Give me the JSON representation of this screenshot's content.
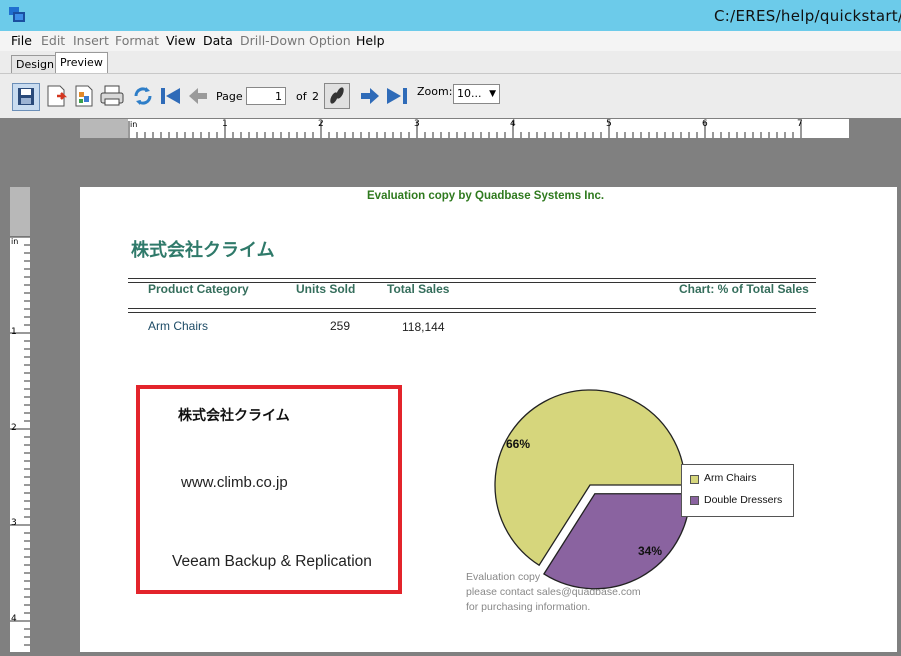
{
  "window": {
    "title": "C:/ERES/help/quickstart/"
  },
  "menu": [
    {
      "label": "File",
      "enabled": true
    },
    {
      "label": "Edit",
      "enabled": false
    },
    {
      "label": "Insert",
      "enabled": false
    },
    {
      "label": "Format",
      "enabled": false
    },
    {
      "label": "View",
      "enabled": true
    },
    {
      "label": "Data",
      "enabled": true
    },
    {
      "label": "Drill-Down",
      "enabled": false
    },
    {
      "label": "Option",
      "enabled": false
    },
    {
      "label": "Help",
      "enabled": true
    }
  ],
  "tabs": [
    {
      "label": "Design"
    },
    {
      "label": "Preview",
      "active": true
    }
  ],
  "toolbar": {
    "page_label": "Page",
    "page_value": "1",
    "of_label": "of",
    "total_pages": "2",
    "zoom_label": "Zoom:",
    "zoom_value": "10..."
  },
  "ruler": {
    "h_unit": "in",
    "h_marks": [
      "1",
      "2",
      "3",
      "4",
      "5",
      "6",
      "7"
    ],
    "v_unit": "in",
    "v_marks": [
      "1",
      "2",
      "3",
      "4"
    ]
  },
  "report": {
    "watermark": "Evaluation copy by Quadbase Systems Inc.",
    "title": "株式会社クライム",
    "headers": {
      "category": "Product Category",
      "units": "Units Sold",
      "sales": "Total Sales",
      "chart": "Chart: % of Total Sales"
    },
    "rows": [
      {
        "category": "Arm Chairs",
        "units": "259",
        "sales": "118,144"
      }
    ],
    "annotation": {
      "line1": "株式会社クライム",
      "line2": "www.climb.co.jp",
      "line3": "Veeam Backup & Replication",
      "border_color": "#e3242b"
    },
    "eval_note": [
      "Evaluation copy",
      "please contact sales@quadbase.com",
      "for purchasing information."
    ]
  },
  "chart_data": {
    "type": "pie",
    "title": "",
    "slices": [
      {
        "name": "Arm Chairs",
        "value": 66,
        "label": "66%",
        "color": "#d6d67c"
      },
      {
        "name": "Double Dressers",
        "value": 34,
        "label": "34%",
        "color": "#8a63a0"
      }
    ],
    "legend_placement": "right"
  }
}
